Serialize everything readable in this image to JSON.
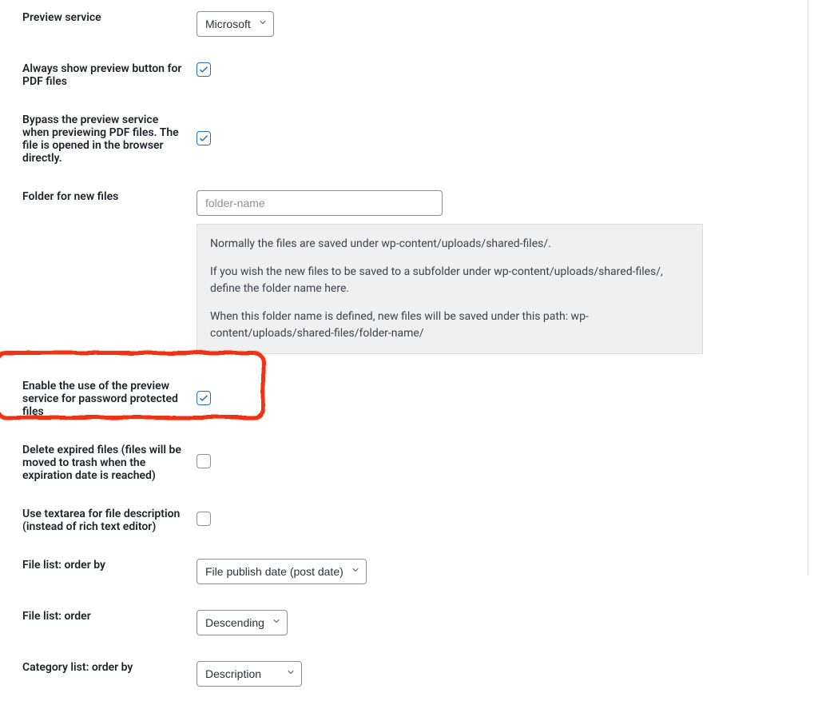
{
  "settings": {
    "preview_service": {
      "label": "Preview service",
      "value": "Microsoft"
    },
    "always_preview_pdf": {
      "label": "Always show preview button for PDF files",
      "checked": true
    },
    "bypass_preview_pdf": {
      "label": "Bypass the preview service when previewing PDF files. The file is opened in the browser directly.",
      "checked": true
    },
    "folder_new_files": {
      "label": "Folder for new files",
      "placeholder": "folder-name",
      "value": "",
      "help1": "Normally the files are saved under wp-content/uploads/shared-files/.",
      "help2": "If you wish the new files to be saved to a subfolder under wp-content/uploads/shared-files/, define the folder name here.",
      "help3": "When this folder name is defined, new files will be saved under this path: wp-content/uploads/shared-files/folder-name/"
    },
    "preview_password_protected": {
      "label": "Enable the use of the preview service for password protected files",
      "checked": true
    },
    "delete_expired": {
      "label": "Delete expired files (files will be moved to trash when the expiration date is reached)",
      "checked": false
    },
    "textarea_description": {
      "label": "Use textarea for file description (instead of rich text editor)",
      "checked": false
    },
    "file_order_by": {
      "label": "File list: order by",
      "value": "File publish date (post date)"
    },
    "file_order": {
      "label": "File list: order",
      "value": "Descending"
    },
    "cat_order_by": {
      "label": "Category list: order by",
      "value": "Description"
    }
  }
}
